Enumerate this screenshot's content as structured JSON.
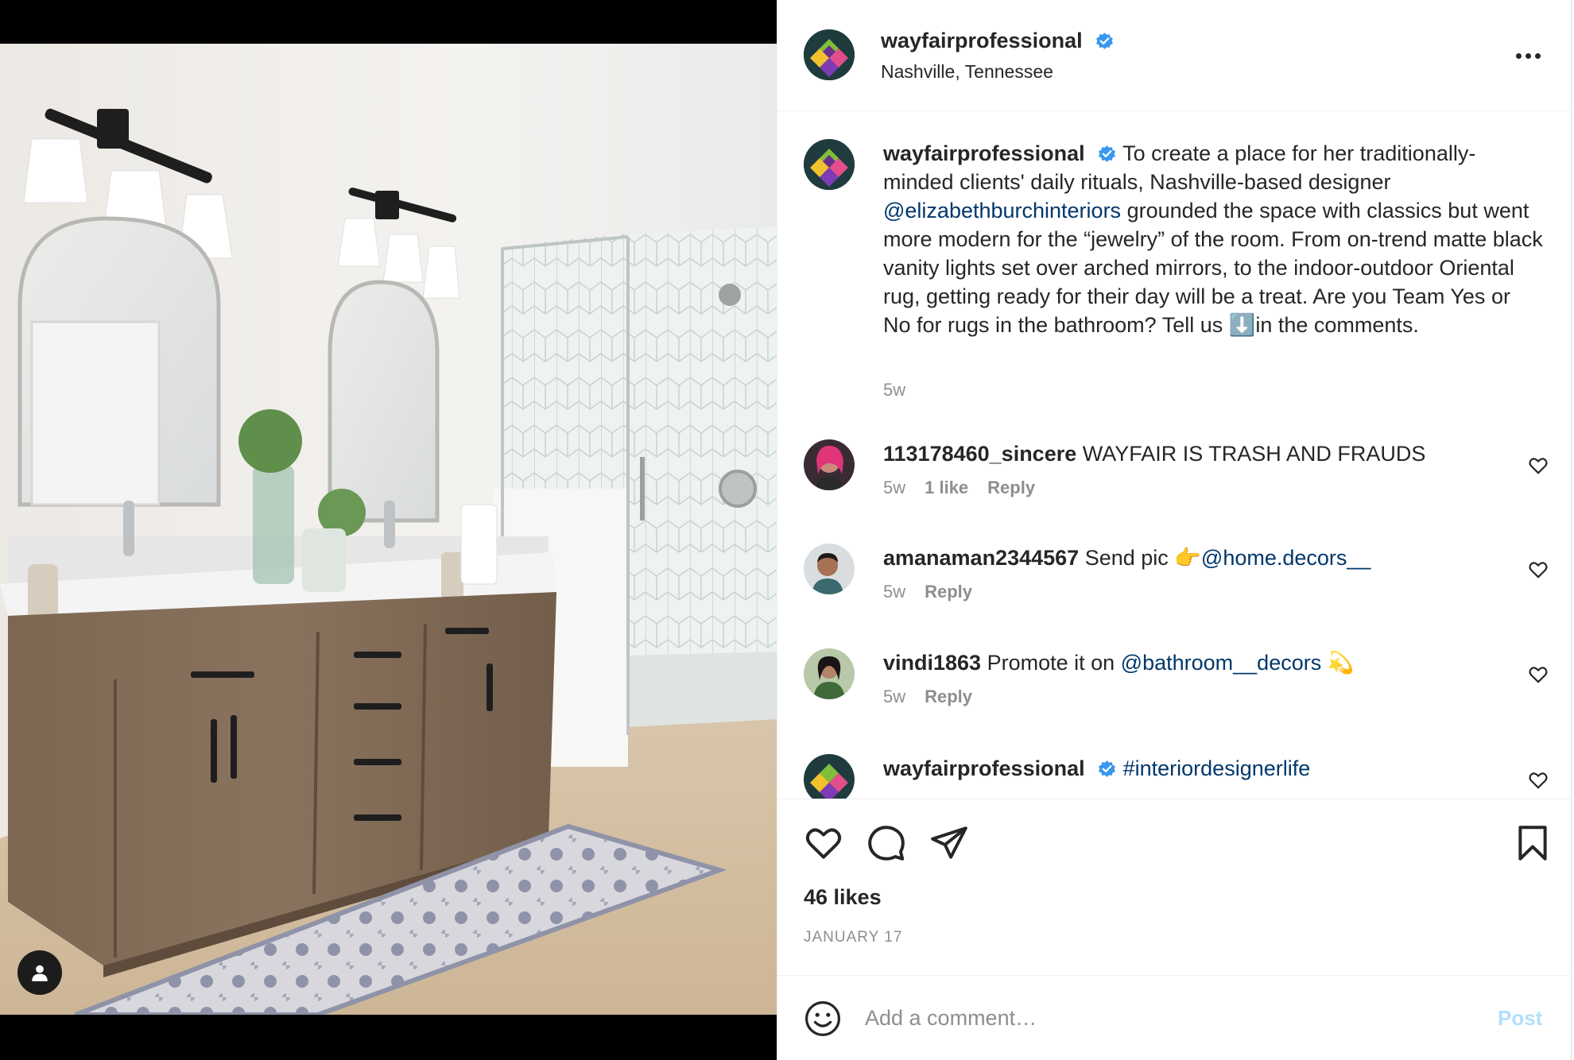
{
  "header": {
    "username": "wayfairprofessional",
    "location": "Nashville, Tennessee"
  },
  "caption": {
    "username": "wayfairprofessional",
    "text_part1": "To create a place for her traditionally-minded clients' daily rituals, Nashville-based designer ",
    "mention": "@elizabethburchinteriors",
    "text_part2": " grounded the space with classics but went more modern for the “jewelry” of the room. From on-trend matte black vanity lights set over arched mirrors, to the indoor-outdoor Oriental rug, getting ready for their day will be a treat. Are you Team Yes or No for rugs in the bathroom? Tell us ⬇️in the comments.",
    "time": "5w"
  },
  "comments": [
    {
      "username": "113178460_sincere",
      "text": "WAYFAIR IS TRASH AND FRAUDS",
      "mention": "",
      "emoji": "",
      "time": "5w",
      "likes": "1 like",
      "reply": "Reply"
    },
    {
      "username": "amanaman2344567",
      "text": "Send pic 👉",
      "mention": "@home.decors__",
      "emoji": "",
      "time": "5w",
      "likes": "",
      "reply": "Reply"
    },
    {
      "username": "vindi1863",
      "text": "Promote it on ",
      "mention": "@bathroom__decors",
      "emoji": " 💫",
      "time": "5w",
      "likes": "",
      "reply": "Reply"
    },
    {
      "username": "wayfairprofessional",
      "text": "",
      "mention": "#interiordesignerlife",
      "emoji": "",
      "time": "",
      "likes": "",
      "reply": ""
    }
  ],
  "actions": {
    "likes": "46 likes",
    "date": "JANUARY 17"
  },
  "add_comment": {
    "placeholder": "Add a comment…",
    "post_label": "Post"
  },
  "colors": {
    "mention": "#00376b",
    "verified": "#3897f0",
    "post_button": "#b2dffc",
    "meta_gray": "#8e8e8e"
  },
  "icons": [
    "user-tag-icon",
    "verified-badge-icon",
    "more-options-icon",
    "heart-icon",
    "comment-icon",
    "share-icon",
    "bookmark-icon",
    "emoji-icon"
  ]
}
